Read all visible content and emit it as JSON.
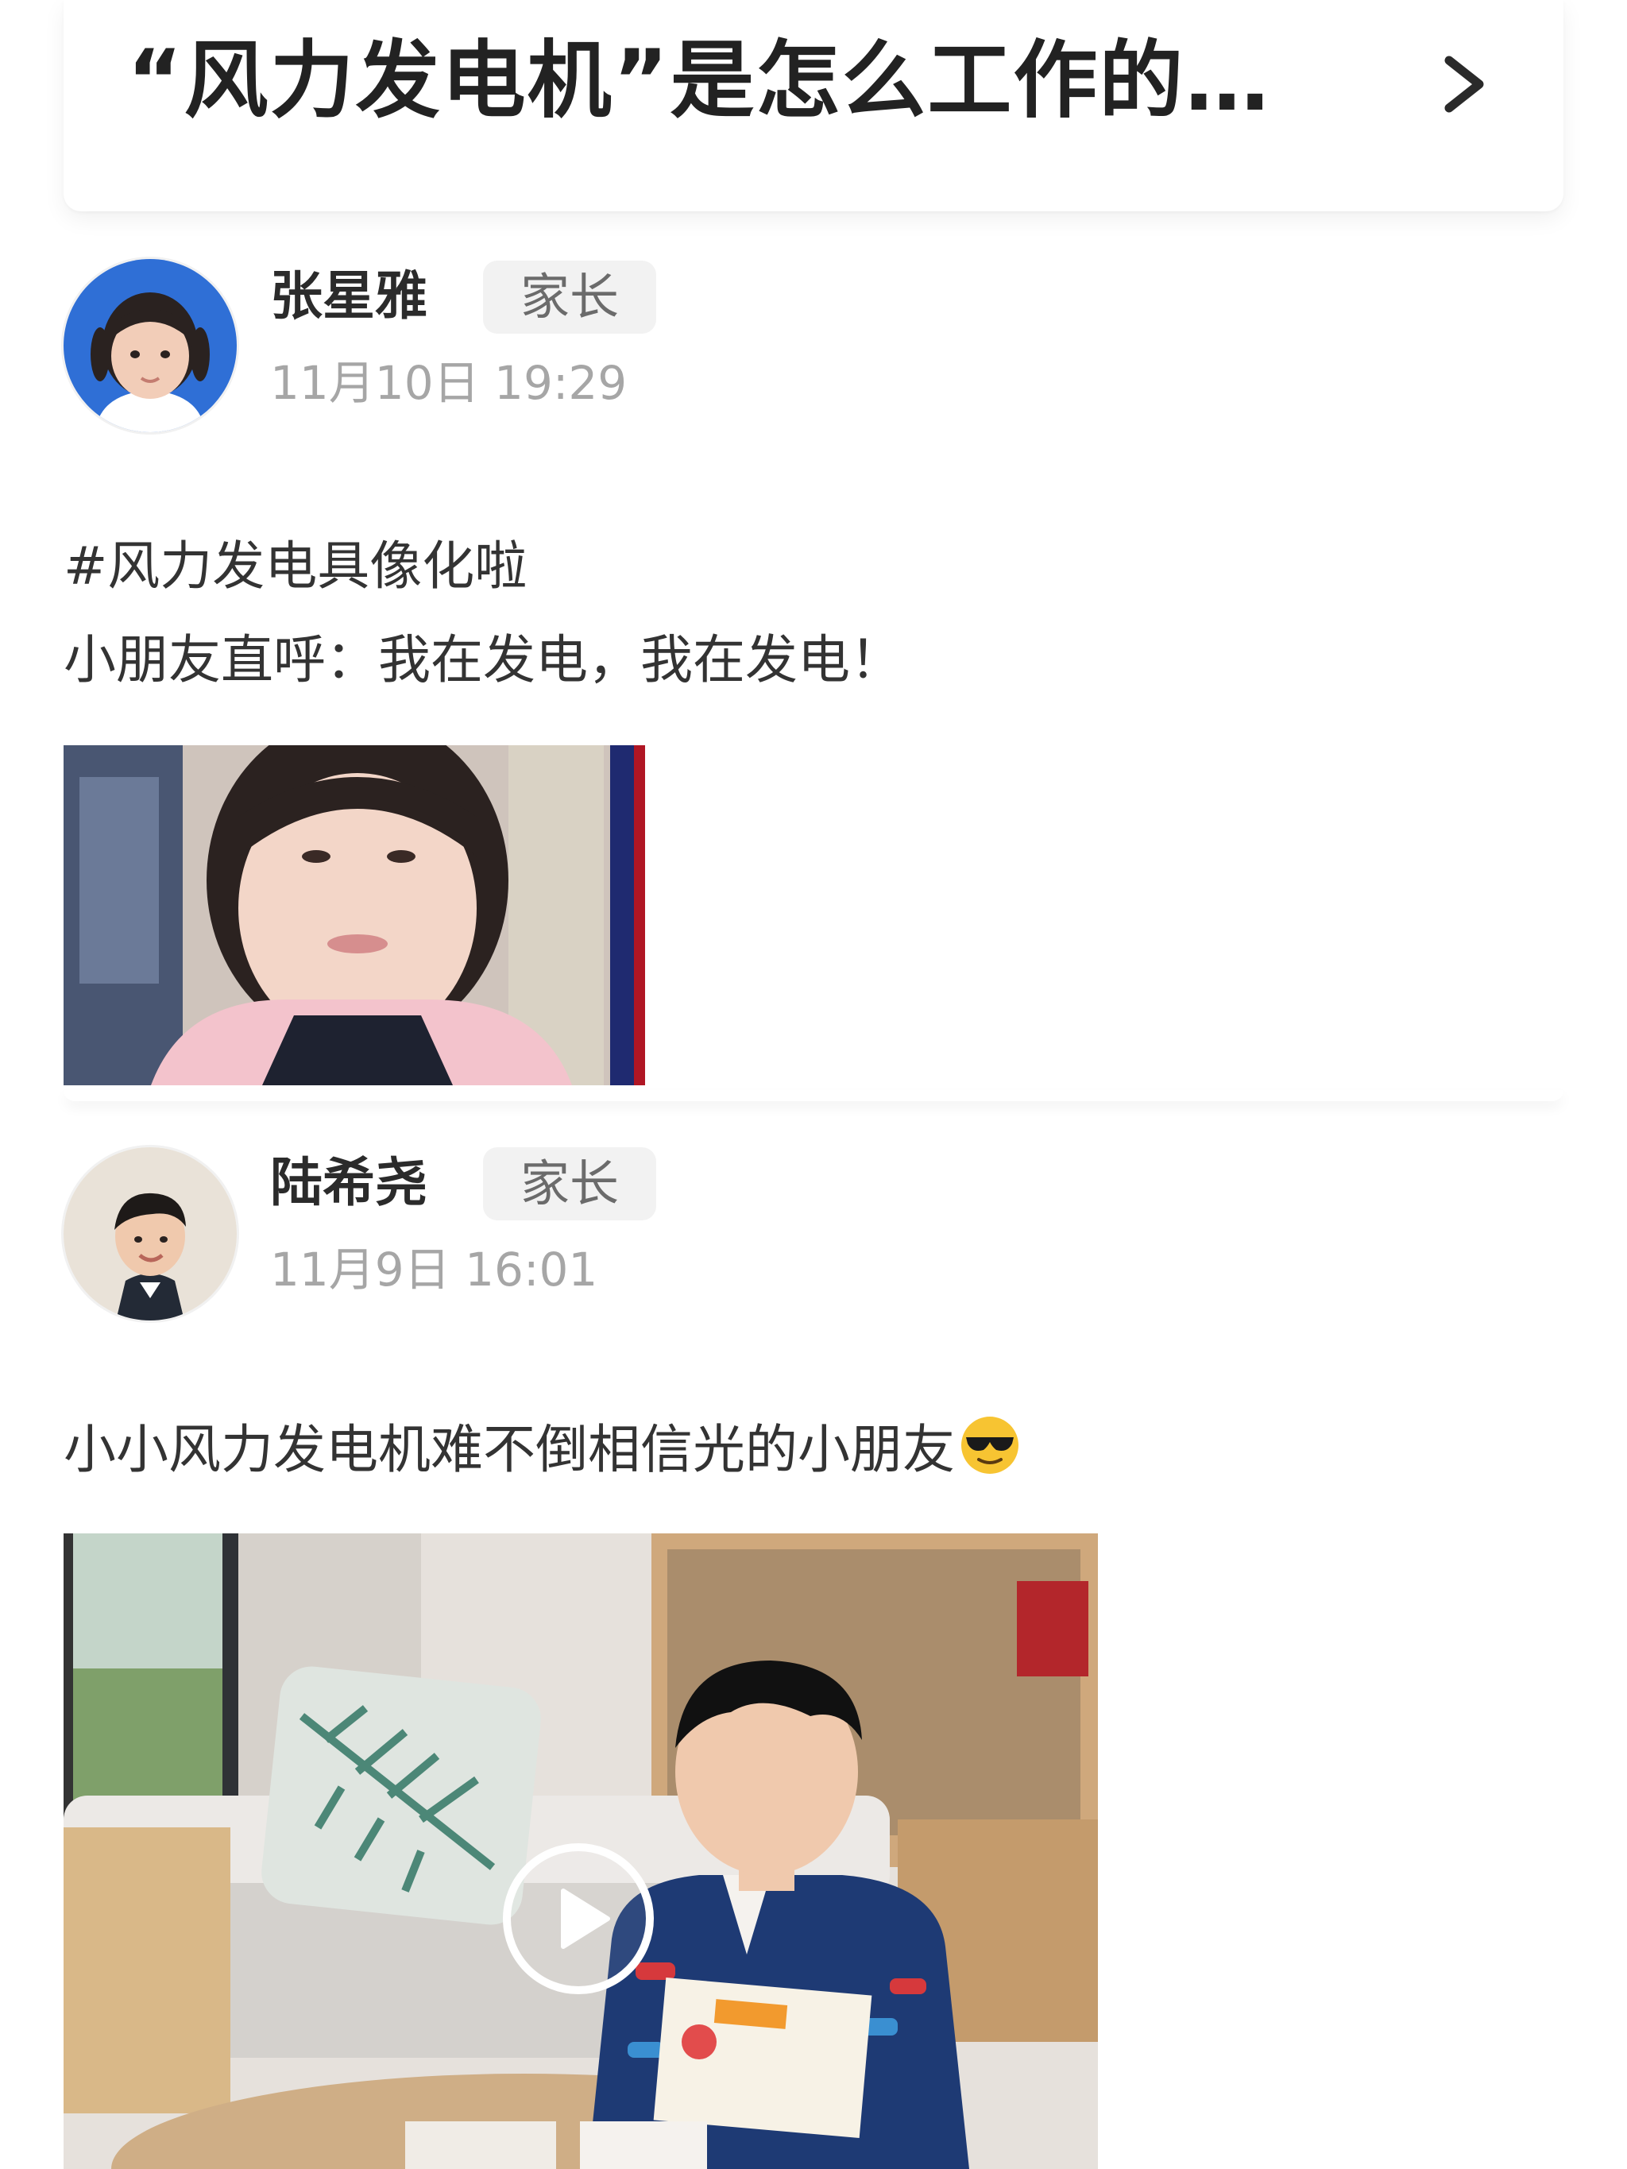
{
  "topic": {
    "title": "“风力发电机”是怎么工作的…"
  },
  "posts": [
    {
      "author": "张星雅",
      "role": "家长",
      "time": "11月10日 19:29",
      "lines": [
        "#风力发电具像化啦",
        "小朋友直呼：我在发电，我在发电！"
      ],
      "media": "photo"
    },
    {
      "author": "陆希尧",
      "role": "家长",
      "time": "11月9日 16:01",
      "lines": [
        "小小风力发电机难不倒相信光的小朋友"
      ],
      "emoji": "sunglasses-face",
      "media": "video"
    }
  ]
}
